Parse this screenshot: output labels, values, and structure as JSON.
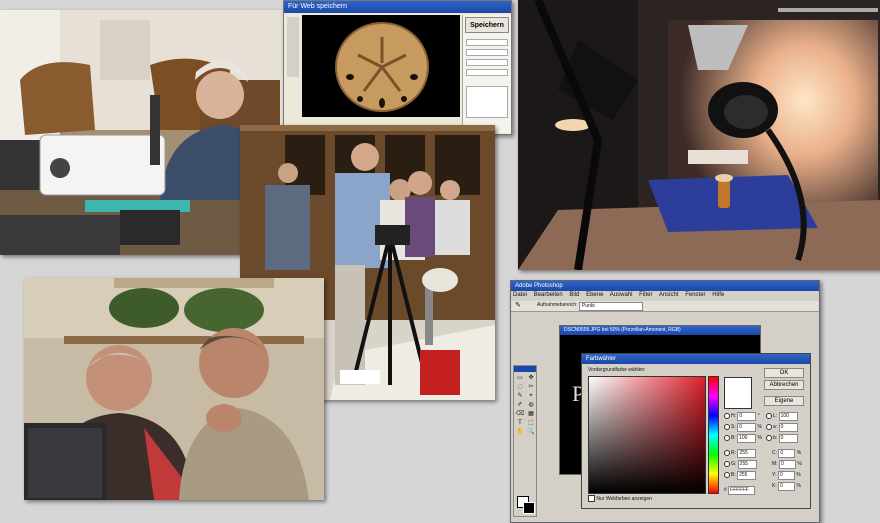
{
  "save_dialog": {
    "title": "Für Web speichern",
    "save_label": "Speichern"
  },
  "photoshop": {
    "title": "Adobe Photoshop",
    "menu": [
      "Datei",
      "Bearbeiten",
      "Bild",
      "Ebene",
      "Auswahl",
      "Filter",
      "Ansicht",
      "Fenster",
      "Hilfe"
    ],
    "options_label": "Aufnahmebereich:",
    "options_value": "Punkt",
    "doc_title": "DSCN0505.JPG bei 50% (Porzellan-Amonent, RGB)",
    "picker": {
      "title": "Farbwähler",
      "prompt": "Vordergrundfarbe wählen:",
      "ok": "OK",
      "cancel": "Abbrechen",
      "custom": "Eigene",
      "web_only": "Nur Webfarben anzeigen",
      "fields": [
        {
          "label": "H:",
          "value": "0",
          "unit": "°"
        },
        {
          "label": "S:",
          "value": "0",
          "unit": "%"
        },
        {
          "label": "B:",
          "value": "100",
          "unit": "%"
        },
        {
          "label": "R:",
          "value": "255",
          "unit": ""
        },
        {
          "label": "G:",
          "value": "255",
          "unit": ""
        },
        {
          "label": "B:",
          "value": "255",
          "unit": ""
        }
      ],
      "lab_fields": [
        {
          "label": "L:",
          "value": "100"
        },
        {
          "label": "a:",
          "value": "0"
        },
        {
          "label": "b:",
          "value": "0"
        }
      ],
      "cmyk_fields": [
        {
          "label": "C:",
          "value": "0",
          "unit": "%"
        },
        {
          "label": "M:",
          "value": "0",
          "unit": "%"
        },
        {
          "label": "Y:",
          "value": "0",
          "unit": "%"
        },
        {
          "label": "K:",
          "value": "0",
          "unit": "%"
        }
      ],
      "hex": "FFFFFF"
    }
  }
}
